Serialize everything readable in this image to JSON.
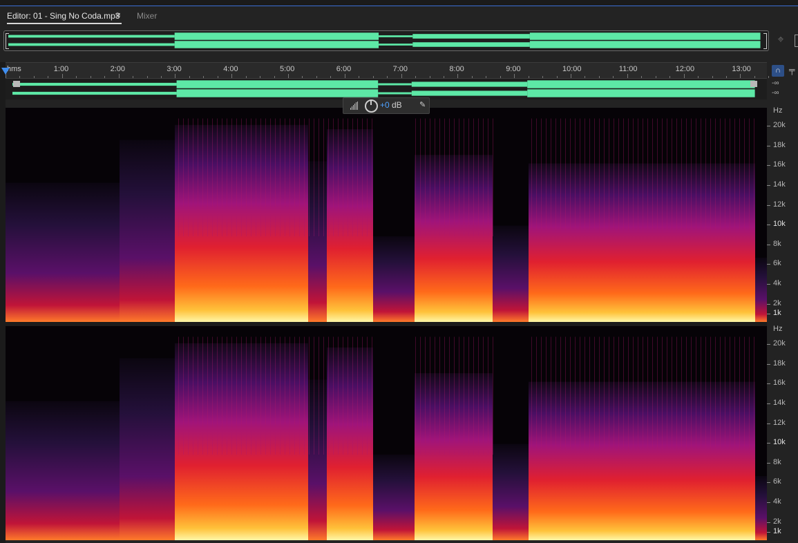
{
  "tabs": {
    "editor_label": "Editor: 01 - Sing No Coda.mp3",
    "mixer_label": "Mixer"
  },
  "ruler": {
    "unit_label": "hms",
    "labels": [
      "1:00",
      "2:00",
      "3:00",
      "4:00",
      "5:00",
      "6:00",
      "7:00",
      "8:00",
      "9:00",
      "10:00",
      "11:00",
      "12:00",
      "13:00"
    ]
  },
  "meters": {
    "channel1_level": "-∞",
    "channel2_level": "-∞"
  },
  "hud": {
    "gain_value": "+0",
    "gain_unit": "dB"
  },
  "frequency_scale": {
    "unit": "Hz",
    "labels": [
      "20k",
      "18k",
      "16k",
      "14k",
      "12k",
      "10k",
      "8k",
      "6k",
      "4k",
      "2k",
      "1k"
    ]
  },
  "colors": {
    "waveform": "#5de8a6",
    "accent": "#3f8ef0",
    "hud_value": "#4ea2ff"
  },
  "icons": {
    "tab_menu": "hamburger-menu-icon",
    "zoom_target": "crosshair-icon",
    "snap": "magnet-icon",
    "pin": "pin-icon",
    "hud_meter": "level-bars-icon",
    "hud_knob": "volume-knob-icon",
    "hud_pin": "pushpin-icon"
  }
}
